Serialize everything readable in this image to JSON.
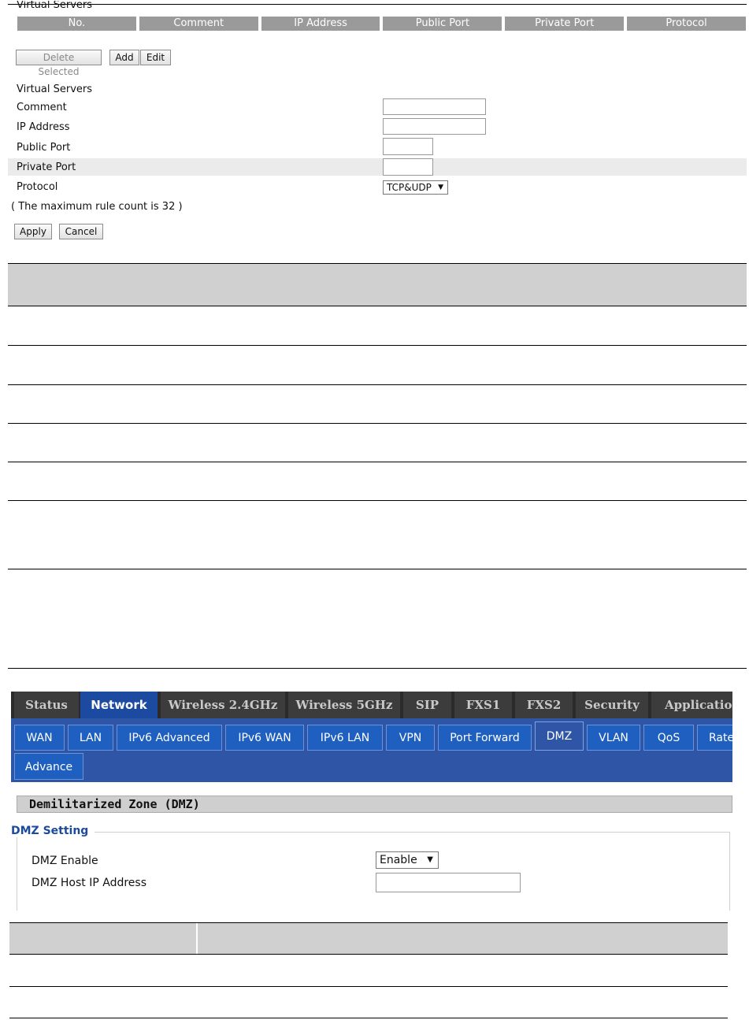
{
  "virtual_servers": {
    "table_title": "Virtual Servers",
    "columns": [
      "No.",
      "Comment",
      "IP Address",
      "Public Port",
      "Private Port",
      "Protocol"
    ],
    "buttons": {
      "delete_selected": "Delete Selected",
      "add": "Add",
      "edit": "Edit"
    },
    "form": {
      "title": "Virtual Servers",
      "comment_label": "Comment",
      "comment_value": "",
      "ip_label": "IP Address",
      "ip_value": "",
      "public_port_label": "Public Port",
      "public_port_value": "",
      "private_port_label": "Private Port",
      "private_port_value": "",
      "protocol_label": "Protocol",
      "protocol_value": "TCP&UDP",
      "note": "( The maximum rule count is 32 )",
      "apply": "Apply",
      "cancel": "Cancel"
    }
  },
  "router": {
    "top_tabs": [
      "Status",
      "Network",
      "Wireless 2.4GHz",
      "Wireless 5GHz",
      "SIP",
      "FXS1",
      "FXS2",
      "Security",
      "Application"
    ],
    "active_top_tab": "Network",
    "sub_tabs": [
      "WAN",
      "LAN",
      "IPv6 Advanced",
      "IPv6 WAN",
      "IPv6 LAN",
      "VPN",
      "Port Forward",
      "DMZ",
      "VLAN",
      "QoS",
      "Rate",
      "Advance"
    ],
    "active_sub_tab": "DMZ",
    "section_title": "Demilitarized Zone (DMZ)",
    "dmz": {
      "legend": "DMZ Setting",
      "enable_label": "DMZ Enable",
      "enable_value": "Enable",
      "host_ip_label": "DMZ Host IP Address",
      "host_ip_value": ""
    }
  },
  "colors": {
    "nav_dark": "#2b2b2b",
    "nav_active": "#1c4aa0",
    "subnav_bg": "#2f56a6",
    "subnav_tab": "#1e5fbf",
    "table_header": "#9a9a9a",
    "legend_text": "#1c4aa0"
  }
}
